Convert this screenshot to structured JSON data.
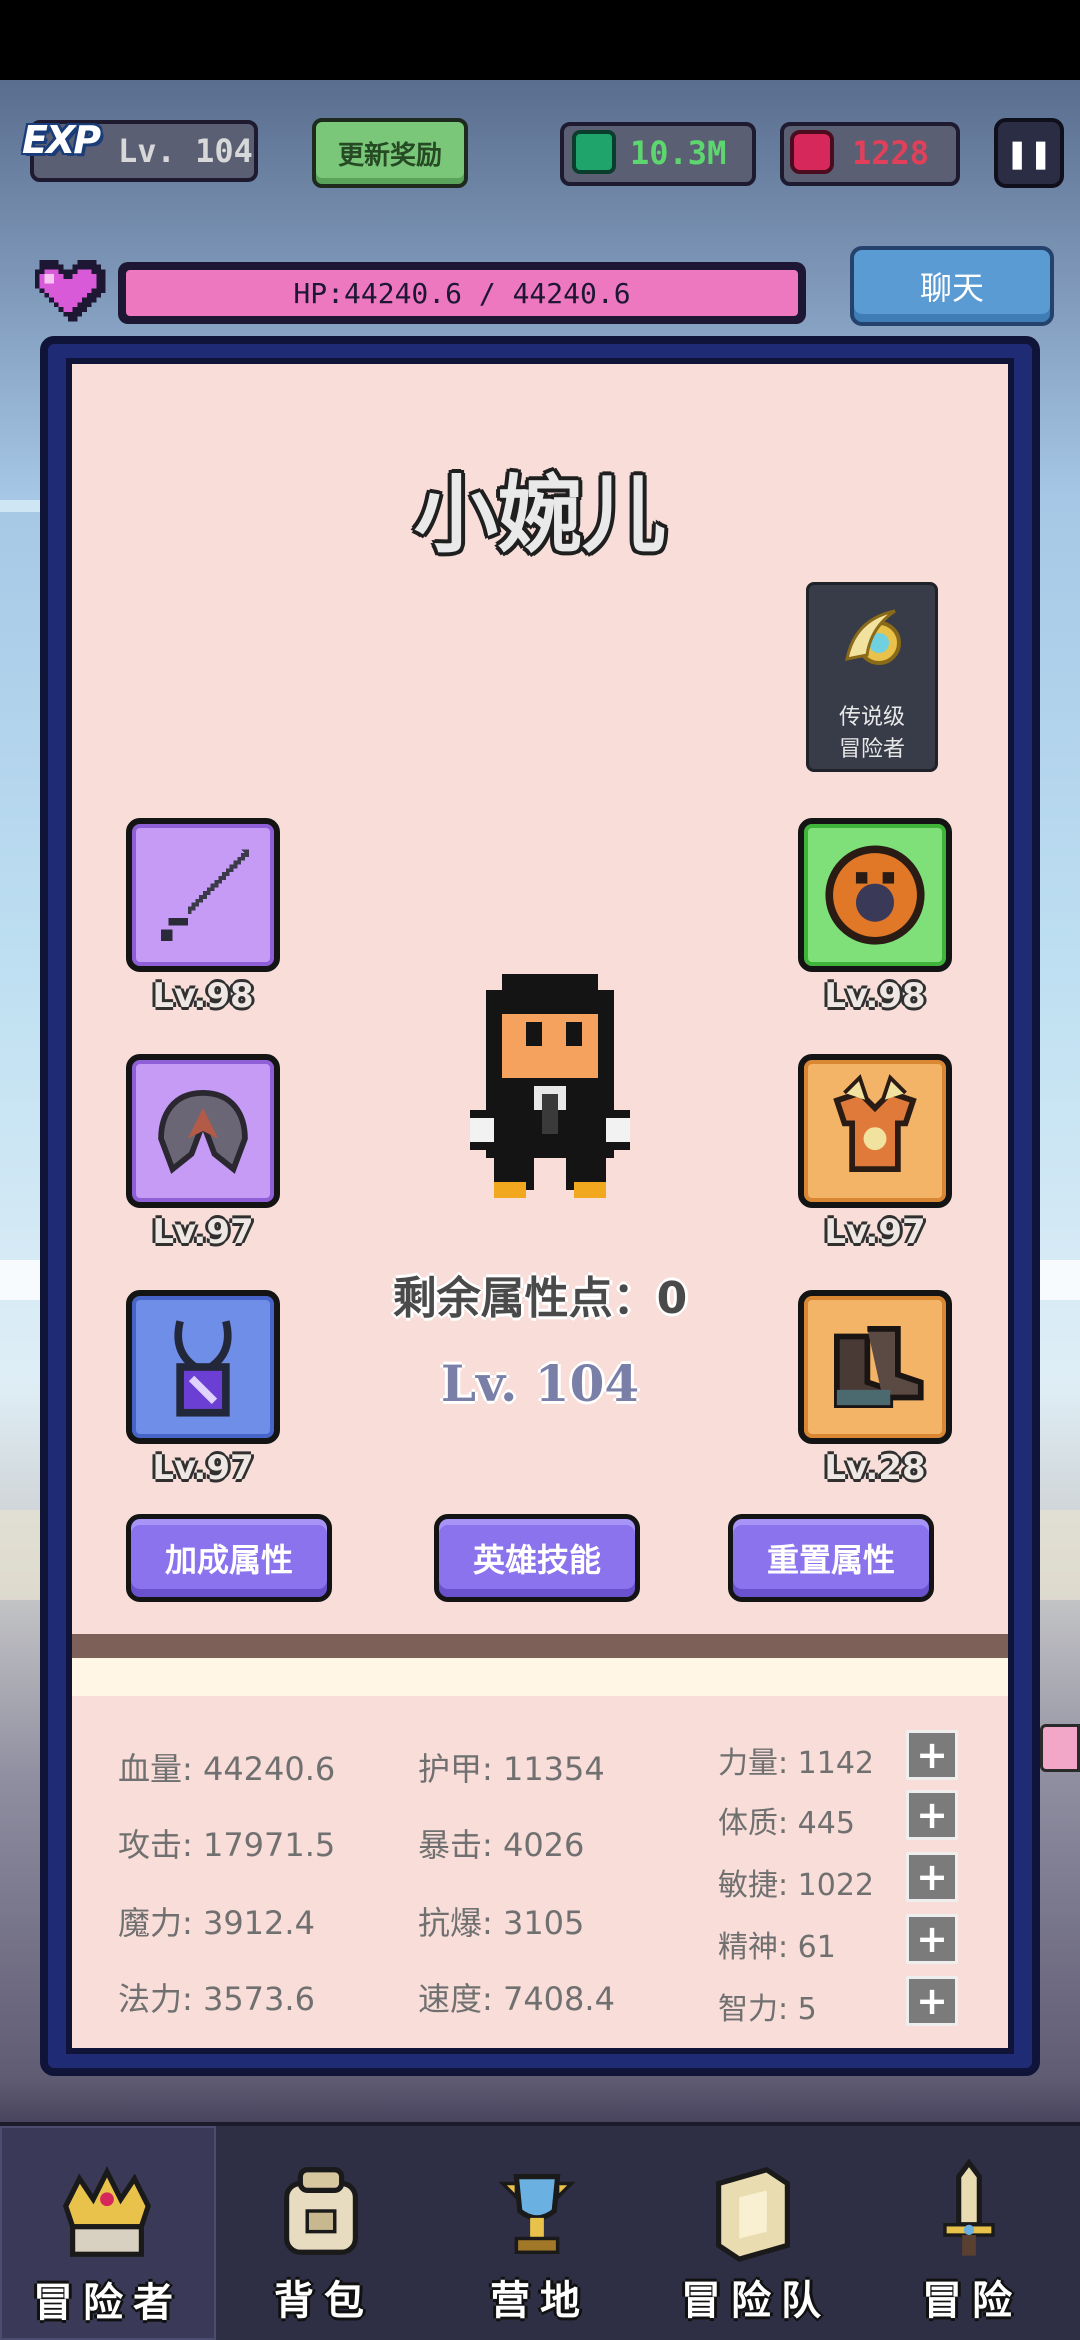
{
  "topbar": {
    "exp_badge": "EXP",
    "level": "Lv. 104",
    "reward_button": "更新奖励",
    "gems": "10.3M",
    "rubies": "1228",
    "pause_symbol": "❚❚"
  },
  "hp": {
    "text": "HP:44240.6 / 44240.6",
    "fill_fraction": 1.0
  },
  "chat_button": "聊天",
  "hero": {
    "name": "小婉儿",
    "rank_badge_line1": "传说级",
    "rank_badge_line2": "冒险者",
    "remaining_points": "剩余属性点：0",
    "level": "Lv. 104"
  },
  "equipment": {
    "left": [
      {
        "icon": "sword-icon",
        "level": "Lv.98"
      },
      {
        "icon": "helmet-icon",
        "level": "Lv.97"
      },
      {
        "icon": "necklace-icon",
        "level": "Lv.97"
      }
    ],
    "right": [
      {
        "icon": "shield-icon",
        "level": "Lv.98"
      },
      {
        "icon": "armor-icon",
        "level": "Lv.97"
      },
      {
        "icon": "boots-icon",
        "level": "Lv.28"
      }
    ]
  },
  "actions": {
    "bonus": "加成属性",
    "skills": "英雄技能",
    "reset": "重置属性"
  },
  "stats": {
    "col1": [
      "血量: 44240.6",
      "攻击: 17971.5",
      "魔力: 3912.4",
      "法力: 3573.6"
    ],
    "col2": [
      "护甲: 11354",
      "暴击: 4026",
      "抗爆: 3105",
      "速度: 7408.4"
    ],
    "attributes": [
      "力量: 1142",
      "体质: 445",
      "敏捷: 1022",
      "精神: 61",
      "智力: 5"
    ],
    "plus_symbol": "+"
  },
  "nav": {
    "items": [
      "冒险者",
      "背包",
      "营地",
      "冒险队",
      "冒险"
    ],
    "active_index": 0
  },
  "colors": {
    "panel_pink": "#f8ddd9",
    "button_purple": "#8b73ee",
    "hp_pink": "#ee78c0",
    "gem_green": "#5dd66f",
    "ruby_red": "#e0405a"
  }
}
